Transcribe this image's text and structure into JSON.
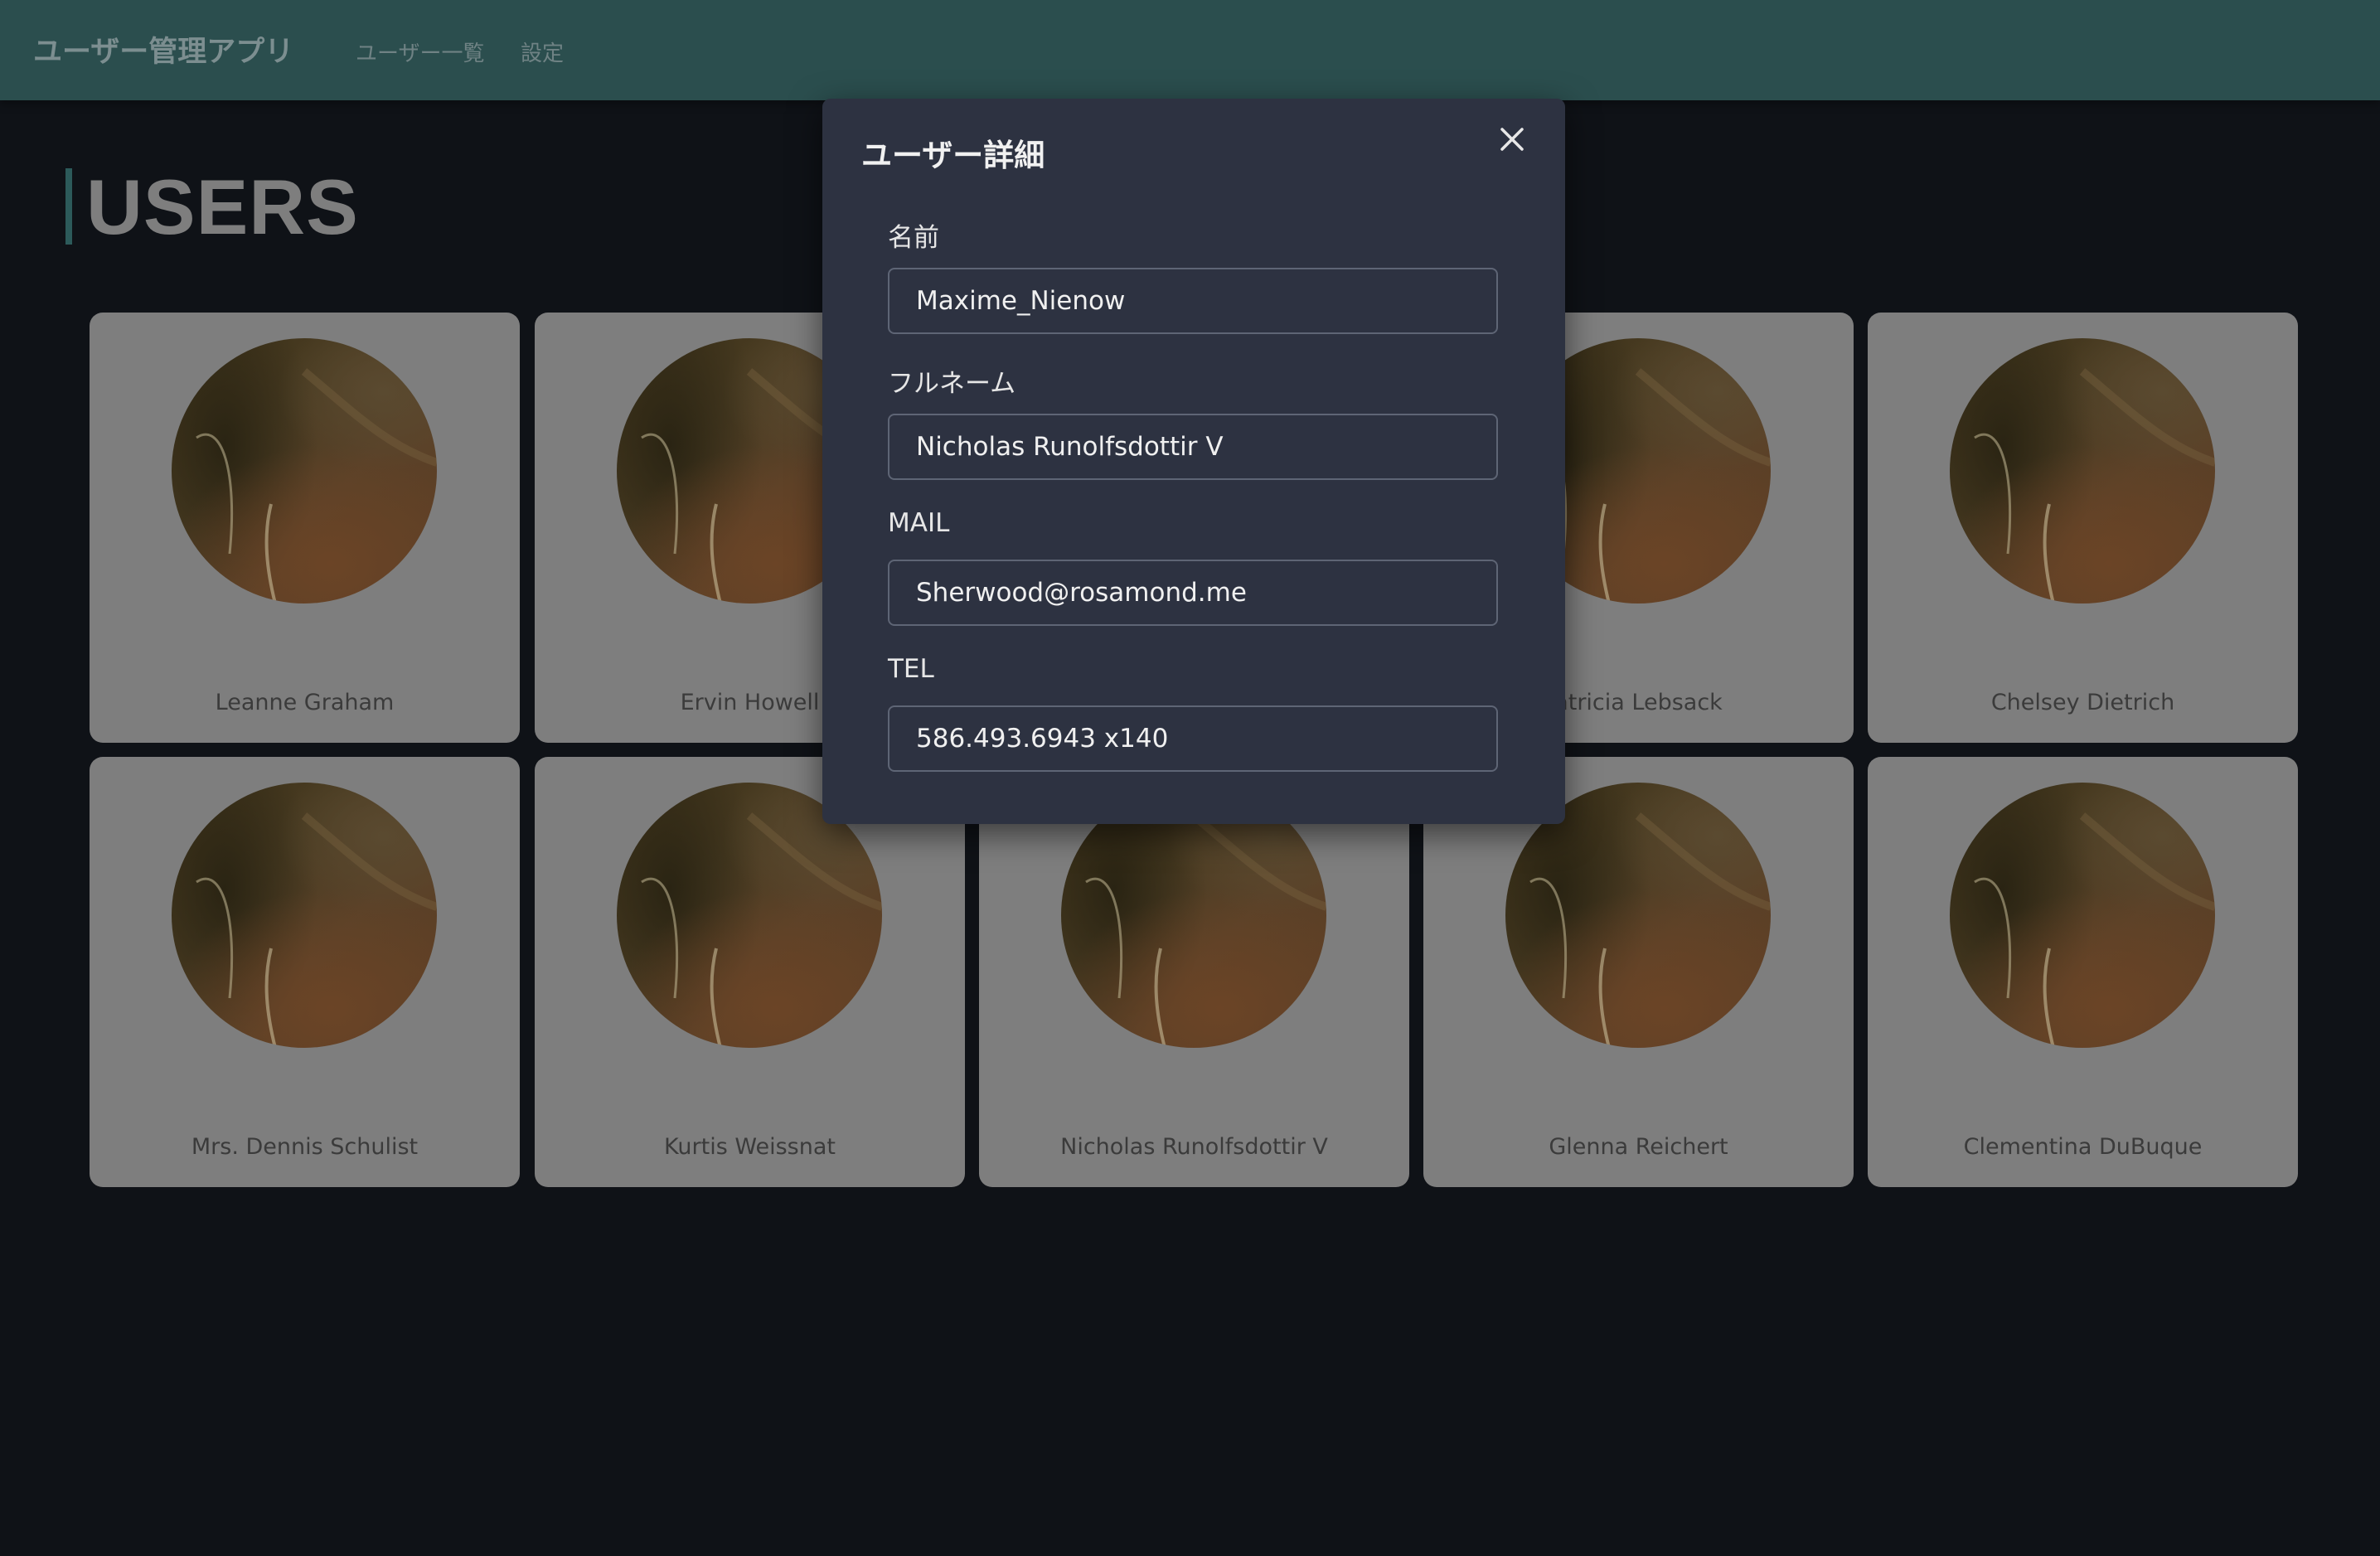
{
  "header": {
    "app_title": "ユーザー管理アプリ",
    "nav": [
      {
        "label": "ユーザー一覧"
      },
      {
        "label": "設定"
      }
    ]
  },
  "page": {
    "title": "USERS"
  },
  "users": [
    {
      "name": "Leanne Graham"
    },
    {
      "name": "Ervin Howell"
    },
    {
      "name": ""
    },
    {
      "name": "atricia Lebsack"
    },
    {
      "name": "Chelsey Dietrich"
    },
    {
      "name": "Mrs. Dennis Schulist"
    },
    {
      "name": "Kurtis Weissnat"
    },
    {
      "name": "Nicholas Runolfsdottir V"
    },
    {
      "name": "Glenna Reichert"
    },
    {
      "name": "Clementina DuBuque"
    }
  ],
  "modal": {
    "title": "ユーザー詳細",
    "close_icon": "close-icon",
    "fields": [
      {
        "label": "名前",
        "value": "Maxime_Nienow"
      },
      {
        "label": "フルネーム",
        "value": "Nicholas Runolfsdottir V"
      },
      {
        "label": "MAIL",
        "value": "Sherwood@rosamond.me"
      },
      {
        "label": "TEL",
        "value": "586.493.6943 x140"
      }
    ]
  },
  "colors": {
    "header_bg": "#2b4e4e",
    "page_bg": "#0f1217",
    "card_bg": "#7e7e7e",
    "modal_bg": "#2d3241"
  }
}
